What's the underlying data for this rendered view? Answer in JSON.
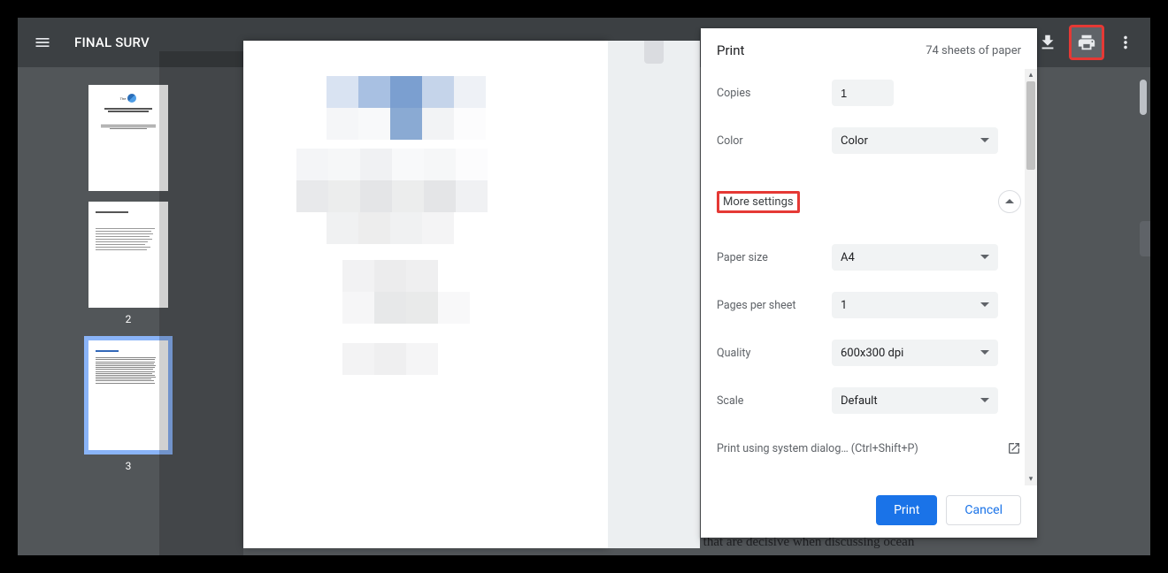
{
  "header": {
    "doc_title": "FINAL SURV"
  },
  "thumbnails": {
    "page2_label": "2",
    "page3_label": "3"
  },
  "print_dialog": {
    "title": "Print",
    "sheets_summary": "74 sheets of paper",
    "copies": {
      "label": "Copies",
      "value": "1"
    },
    "color": {
      "label": "Color",
      "value": "Color"
    },
    "more_settings_label": "More settings",
    "paper_size": {
      "label": "Paper size",
      "value": "A4"
    },
    "pages_per_sheet": {
      "label": "Pages per sheet",
      "value": "1"
    },
    "quality": {
      "label": "Quality",
      "value": "600x300 dpi"
    },
    "scale": {
      "label": "Scale",
      "value": "Default"
    },
    "system_dialog": "Print using system dialog… (Ctrl+Shift+P)",
    "print_btn": "Print",
    "cancel_btn": "Cancel"
  },
  "background_text": "analysis, which identified values and beliefs that are decisive when discussing ocean"
}
